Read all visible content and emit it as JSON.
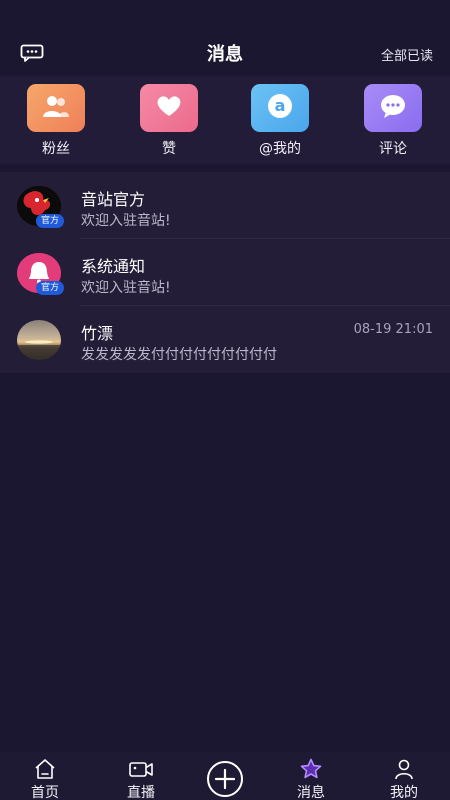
{
  "header": {
    "title": "消息",
    "read_all": "全部已读",
    "left_icon": "chat-dots-icon"
  },
  "shortcuts": [
    {
      "label": "粉丝",
      "icon": "fans-icon",
      "color": "#f0a060"
    },
    {
      "label": "赞",
      "icon": "heart-icon",
      "color": "#f07b9c"
    },
    {
      "label": "@我的",
      "icon": "at-icon",
      "color": "#5ab5f0"
    },
    {
      "label": "评论",
      "icon": "comment-icon",
      "color": "#9a7cf2"
    }
  ],
  "messages": [
    {
      "name": "音站官方",
      "preview": "欢迎入驻音站!",
      "time": "",
      "badge": "官方"
    },
    {
      "name": "系统通知",
      "preview": "欢迎入驻音站!",
      "time": "",
      "badge": "官方"
    },
    {
      "name": "竹漂",
      "preview": "发发发发发付付付付付付付付付",
      "time": "08-19 21:01",
      "badge": ""
    }
  ],
  "tabbar": [
    {
      "label": "首页",
      "icon": "home-icon"
    },
    {
      "label": "直播",
      "icon": "video-icon"
    },
    {
      "label": "",
      "icon": "add-circle-icon"
    },
    {
      "label": "消息",
      "icon": "star-icon"
    },
    {
      "label": "我的",
      "icon": "user-icon"
    }
  ]
}
